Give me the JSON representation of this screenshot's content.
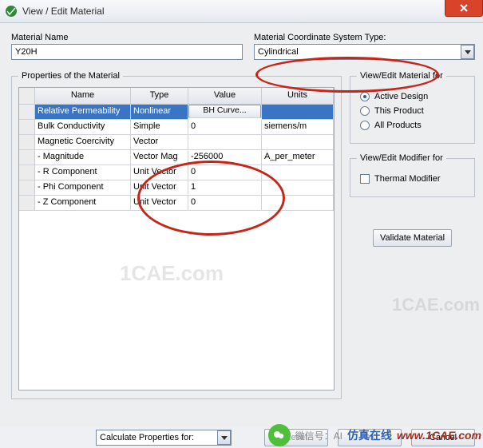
{
  "window": {
    "title": "View / Edit Material",
    "close_glyph": "×"
  },
  "labels": {
    "material_name": "Material Name",
    "coord_label": "Material Coordinate System Type:"
  },
  "material_name_value": "Y20H",
  "coord_value": "Cylindrical",
  "group_properties": "Properties of the Material",
  "group_viewfor": "View/Edit Material for",
  "group_modifier": "View/Edit Modifier for",
  "view_for": {
    "active": "Active Design",
    "product": "This Product",
    "all": "All Products"
  },
  "modifier": {
    "thermal": "Thermal Modifier"
  },
  "table_headers": {
    "name": "Name",
    "type": "Type",
    "value": "Value",
    "units": "Units"
  },
  "rows": [
    {
      "name": "Relative Permeability",
      "type": "Nonlinear",
      "value_btn": "BH Curve...",
      "units": "",
      "sel": true,
      "btn": true
    },
    {
      "name": "Bulk Conductivity",
      "type": "Simple",
      "value": "0",
      "units": "siemens/m"
    },
    {
      "name": "Magnetic Coercivity",
      "type": "Vector",
      "value": "",
      "units": ""
    },
    {
      "name": "- Magnitude",
      "type": "Vector Mag",
      "value": "-256000",
      "units": "A_per_meter"
    },
    {
      "name": "- R Component",
      "type": "Unit Vector",
      "value": "0",
      "units": ""
    },
    {
      "name": "- Phi Component",
      "type": "Unit Vector",
      "value": "1",
      "units": ""
    },
    {
      "name": "- Z Component",
      "type": "Unit Vector",
      "value": "0",
      "units": ""
    }
  ],
  "validate_btn": "Validate Material",
  "calc_label": "Calculate Properties for:",
  "buttons": {
    "reset": "Reset",
    "ok": "OK",
    "cancel": "Cancel"
  },
  "watermark": "1CAE.com",
  "overlay": {
    "wx": "微信号：AI",
    "cn": "仿真在线",
    "url": "www.1CAE.com"
  }
}
